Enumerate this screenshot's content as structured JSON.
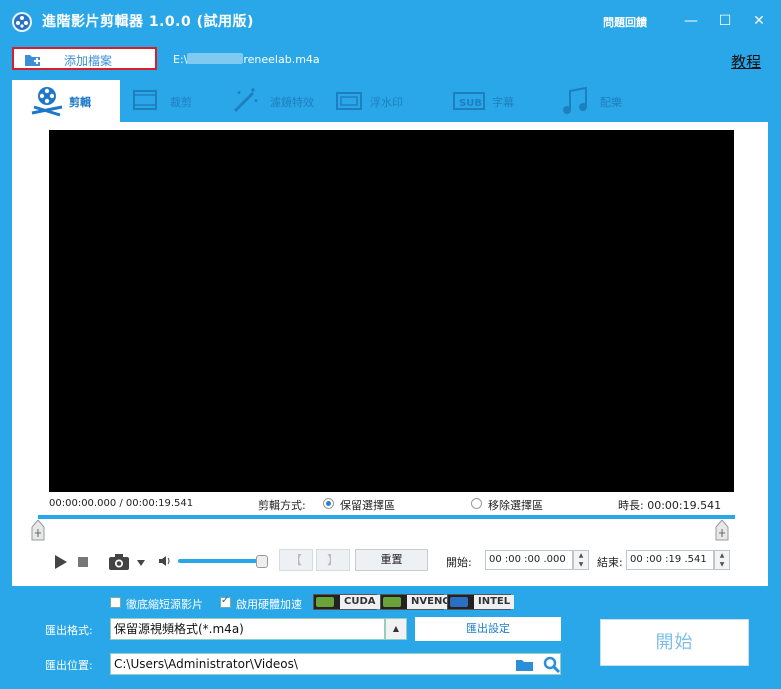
{
  "window": {
    "title": "進階影片剪輯器 1.0.0 (試用版)",
    "feedback": "問題回饋",
    "min_glyph": "—",
    "max_glyph": "☐",
    "close_glyph": "✕"
  },
  "file": {
    "add_label": "添加檔案",
    "path_prefix": "E:\\",
    "path_suffix": "reneelab.m4a"
  },
  "tutorial": "教程",
  "tabs": [
    {
      "label": "剪輯",
      "icon": "film-reel-icon",
      "active": true
    },
    {
      "label": "裁剪",
      "icon": "crop-icon"
    },
    {
      "label": "濾鏡特效",
      "icon": "magic-wand-icon"
    },
    {
      "label": "浮水印",
      "icon": "watermark-icon"
    },
    {
      "label": "字幕",
      "icon": "subtitle-icon"
    },
    {
      "label": "配樂",
      "icon": "music-note-icon"
    }
  ],
  "player": {
    "time_display": "00:00:00.000 / 00:00:19.541",
    "cut_mode_label": "剪輯方式:",
    "keep_label": "保留選擇區",
    "remove_label": "移除選擇區",
    "duration": "時長: 00:00:19.541",
    "reset_label": "重置",
    "start_label": "開始:",
    "start_value": "00 :00 :00 .000",
    "end_label": "結束:",
    "end_value": "00 :00 :19 .541",
    "bracket_left": "【",
    "bracket_right": "】"
  },
  "options": {
    "shrink_label": "徹底縮短源影片",
    "hw_accel_label": "啟用硬體加速",
    "hw_cuda": "CUDA",
    "hw_nvenc": "NVENC",
    "hw_intel": "INTEL"
  },
  "export": {
    "format_label": "匯出格式:",
    "format_value": "保留源視頻格式(*.m4a)",
    "settings_label": "匯出設定",
    "location_label": "匯出位置:",
    "location_value": "C:\\Users\\Administrator\\Videos\\",
    "start_button": "開始"
  },
  "colors": {
    "background": "#2aa7e9",
    "highlight_border": "#d81e2a"
  }
}
